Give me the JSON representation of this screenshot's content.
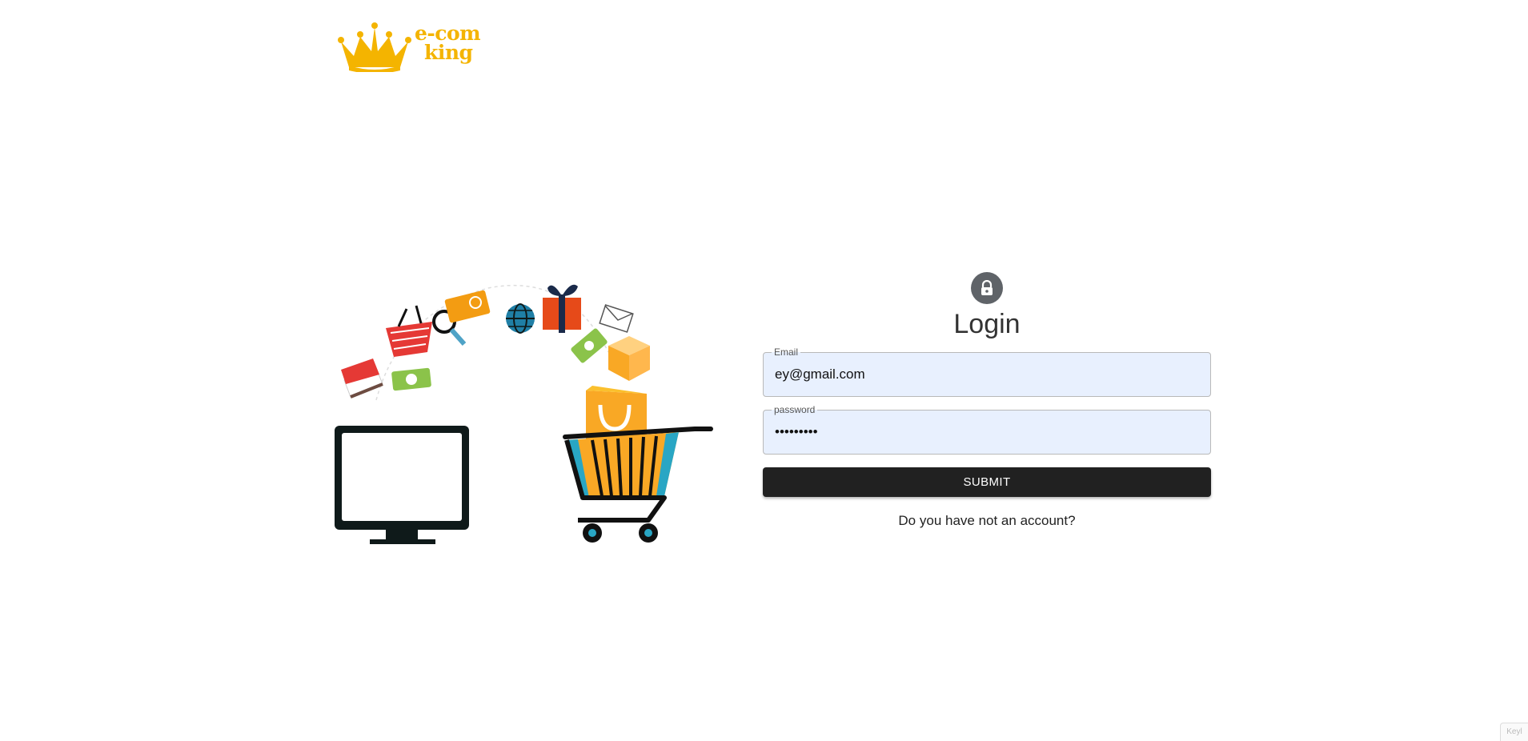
{
  "header": {
    "logo_line1": "e-com",
    "logo_line2": "king",
    "logo_color": "#f4b400"
  },
  "login": {
    "icon": "lock-icon",
    "title": "Login",
    "email_label": "Email",
    "email_value": "ey@gmail.com",
    "password_label": "password",
    "password_value": "•••••••••",
    "submit_label": "SUBMIT",
    "signup_link": "Do you have not an account?",
    "field_bg": "#e8f0fe",
    "button_color": "#212121"
  },
  "corner_widget": {
    "text": "Keyl"
  }
}
